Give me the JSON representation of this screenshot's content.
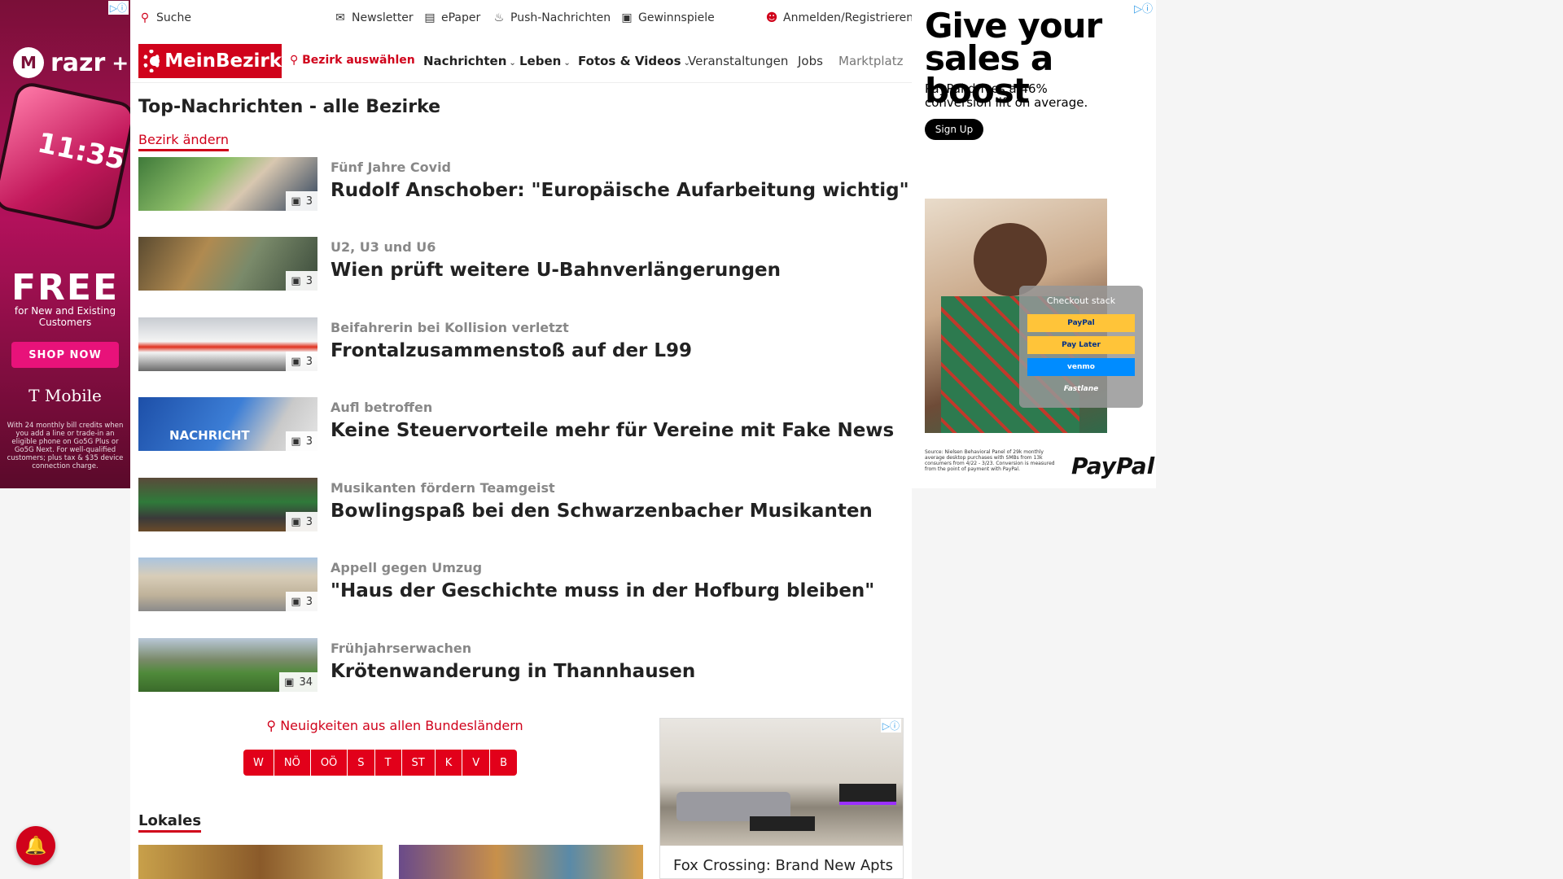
{
  "topbar": {
    "search": "Suche",
    "newsletter": "Newsletter",
    "epaper": "ePaper",
    "push": "Push-Nachrichten",
    "gewinnspiele": "Gewinnspiele",
    "login": "Anmelden/Registrieren"
  },
  "nav": {
    "logo": "MeinBezirk",
    "district": "Bezirk auswählen",
    "items": [
      "Nachrichten",
      "Leben",
      "Fotos & Videos",
      "Veranstaltungen",
      "Jobs",
      "Marktplatz"
    ]
  },
  "page": {
    "title": "Top-Nachrichten - alle Bezirke",
    "change_district": "Bezirk ändern"
  },
  "articles": [
    {
      "kicker": "Fünf Jahre Covid",
      "headline": "Rudolf Anschober: \"Europäische Aufarbeitung wichtig\"",
      "images": "3"
    },
    {
      "kicker": "U2, U3 und U6",
      "headline": "Wien prüft weitere U-Bahnverlängerungen",
      "images": "3"
    },
    {
      "kicker": "Beifahrerin bei Kollision verletzt",
      "headline": "Frontalzusammenstoß auf der L99",
      "images": "3"
    },
    {
      "kicker": "Aufl betroffen",
      "headline": "Keine Steuervorteile mehr für Vereine mit Fake News",
      "images": "3",
      "thumb_text": "NACHRICHT"
    },
    {
      "kicker": "Musikanten fördern Teamgeist",
      "headline": "Bowlingspaß bei den Schwarzenbacher Musikanten",
      "images": "3"
    },
    {
      "kicker": "Appell gegen Umzug",
      "headline": "\"Haus der Geschichte muss in der Hofburg bleiben\"",
      "images": "3"
    },
    {
      "kicker": "Frühjahrserwachen",
      "headline": "Krötenwanderung in Thannhausen",
      "images": "34"
    }
  ],
  "states": {
    "label": "Neuigkeiten aus allen Bundesländern",
    "buttons": [
      "W",
      "NÖ",
      "OÖ",
      "S",
      "T",
      "ST",
      "K",
      "V",
      "B"
    ]
  },
  "lokales": "Lokales",
  "left_ad": {
    "brand": "razr",
    "brand_sup": "+",
    "phone_time": "11:35",
    "free": "FREE",
    "free_sub": "for New and Existing Customers",
    "cta": "SHOP NOW",
    "advertiser": "T Mobile",
    "fine": "With 24 monthly bill credits when you add a line or trade-in an eligible phone on Go5G Plus or Go5G Next. For well-qualified customers; plus tax & $35 device connection charge."
  },
  "right_ad": {
    "headline": "Give your sales a boost",
    "sub": "PayPal drives a 46% conversion lift on average.",
    "cta": "Sign Up",
    "checkout_title": "Checkout stack",
    "options": [
      "PayPal",
      "Pay Later",
      "venmo",
      "Fastlane"
    ],
    "fine": "Source: Nielsen Behavioral Panel of 29k monthly average desktop purchases with SMBs from 13k consumers from 4/22 - 3/23. Conversion is measured from the point of payment with PayPal.",
    "logo": "PayPal"
  },
  "fox_ad": {
    "text": "Fox Crossing: Brand New Apts"
  },
  "colors": {
    "brand_red": "#d0021b",
    "ad_badge": "#3aa0e8"
  }
}
